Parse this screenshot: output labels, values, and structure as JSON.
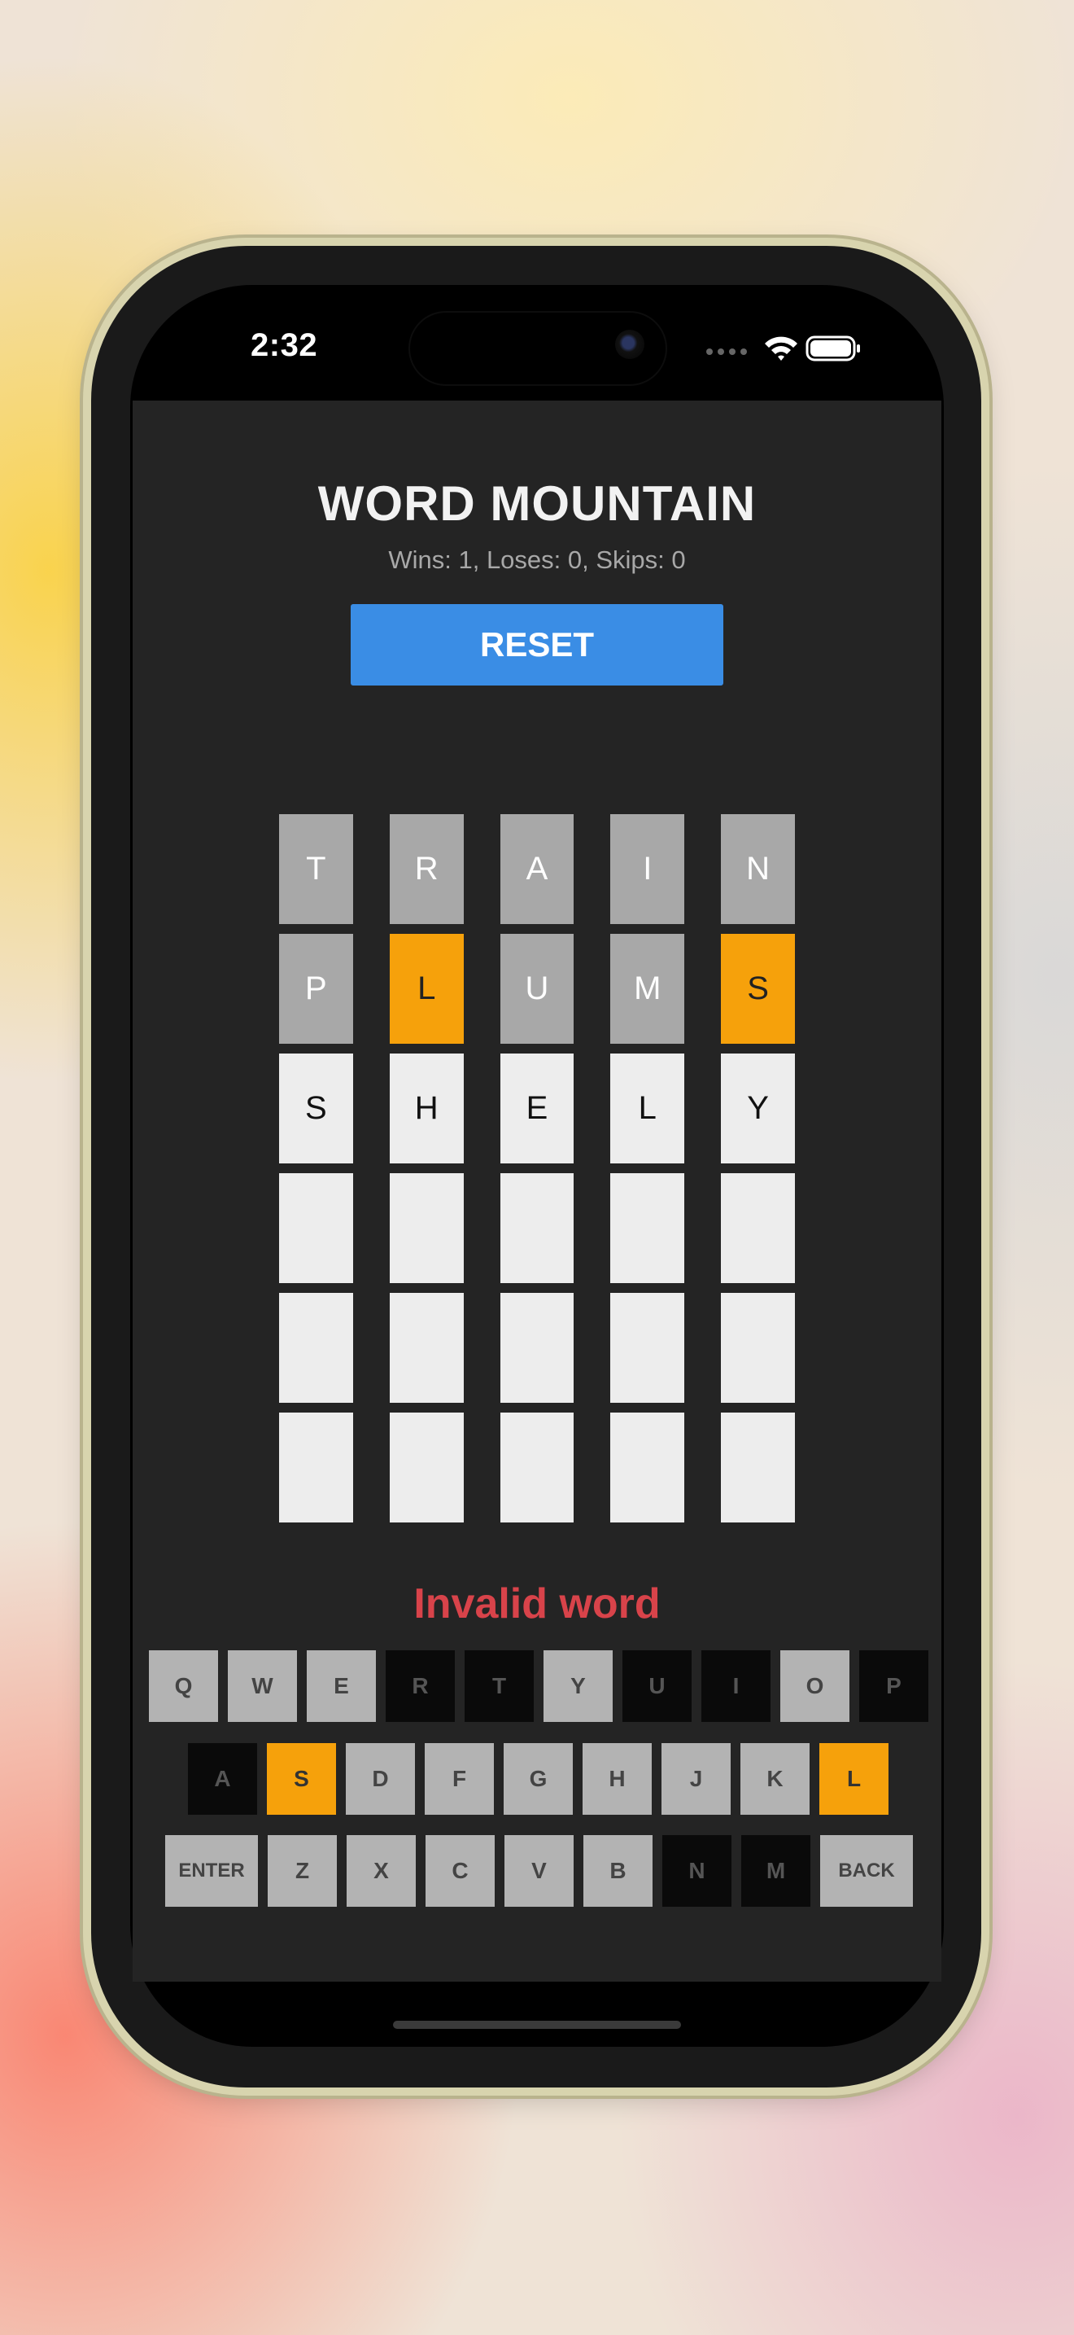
{
  "status_bar": {
    "time": "2:32"
  },
  "app": {
    "title": "WORD MOUNTAIN",
    "stats": "Wins: 1, Loses: 0, Skips: 0",
    "reset_label": "RESET",
    "message": "Invalid word",
    "colors": {
      "gray": "#a8a8a8",
      "orange": "#f6a10b",
      "white": "#ededed",
      "button_blue": "#3a8de5",
      "message_red": "#d8434a",
      "background": "#242424"
    }
  },
  "board": {
    "rows": [
      [
        {
          "letter": "T",
          "state": "gray"
        },
        {
          "letter": "R",
          "state": "gray"
        },
        {
          "letter": "A",
          "state": "gray"
        },
        {
          "letter": "I",
          "state": "gray"
        },
        {
          "letter": "N",
          "state": "gray"
        }
      ],
      [
        {
          "letter": "P",
          "state": "gray"
        },
        {
          "letter": "L",
          "state": "orange"
        },
        {
          "letter": "U",
          "state": "gray"
        },
        {
          "letter": "M",
          "state": "gray"
        },
        {
          "letter": "S",
          "state": "orange"
        }
      ],
      [
        {
          "letter": "S",
          "state": "white"
        },
        {
          "letter": "H",
          "state": "white"
        },
        {
          "letter": "E",
          "state": "white"
        },
        {
          "letter": "L",
          "state": "white"
        },
        {
          "letter": "Y",
          "state": "white"
        }
      ],
      [
        {
          "letter": "",
          "state": "empty"
        },
        {
          "letter": "",
          "state": "empty"
        },
        {
          "letter": "",
          "state": "empty"
        },
        {
          "letter": "",
          "state": "empty"
        },
        {
          "letter": "",
          "state": "empty"
        }
      ],
      [
        {
          "letter": "",
          "state": "empty"
        },
        {
          "letter": "",
          "state": "empty"
        },
        {
          "letter": "",
          "state": "empty"
        },
        {
          "letter": "",
          "state": "empty"
        },
        {
          "letter": "",
          "state": "empty"
        }
      ],
      [
        {
          "letter": "",
          "state": "empty"
        },
        {
          "letter": "",
          "state": "empty"
        },
        {
          "letter": "",
          "state": "empty"
        },
        {
          "letter": "",
          "state": "empty"
        },
        {
          "letter": "",
          "state": "empty"
        }
      ]
    ]
  },
  "keyboard": {
    "rows": [
      [
        {
          "label": "Q",
          "state": "default"
        },
        {
          "label": "W",
          "state": "default"
        },
        {
          "label": "E",
          "state": "default"
        },
        {
          "label": "R",
          "state": "used"
        },
        {
          "label": "T",
          "state": "used"
        },
        {
          "label": "Y",
          "state": "default"
        },
        {
          "label": "U",
          "state": "used"
        },
        {
          "label": "I",
          "state": "used"
        },
        {
          "label": "O",
          "state": "default"
        },
        {
          "label": "P",
          "state": "used"
        }
      ],
      [
        {
          "label": "A",
          "state": "used"
        },
        {
          "label": "S",
          "state": "present"
        },
        {
          "label": "D",
          "state": "default"
        },
        {
          "label": "F",
          "state": "default"
        },
        {
          "label": "G",
          "state": "default"
        },
        {
          "label": "H",
          "state": "default"
        },
        {
          "label": "J",
          "state": "default"
        },
        {
          "label": "K",
          "state": "default"
        },
        {
          "label": "L",
          "state": "present"
        }
      ],
      [
        {
          "label": "ENTER",
          "state": "default"
        },
        {
          "label": "Z",
          "state": "default"
        },
        {
          "label": "X",
          "state": "default"
        },
        {
          "label": "C",
          "state": "default"
        },
        {
          "label": "V",
          "state": "default"
        },
        {
          "label": "B",
          "state": "default"
        },
        {
          "label": "N",
          "state": "used"
        },
        {
          "label": "M",
          "state": "used"
        },
        {
          "label": "BACK",
          "state": "default"
        }
      ]
    ]
  }
}
